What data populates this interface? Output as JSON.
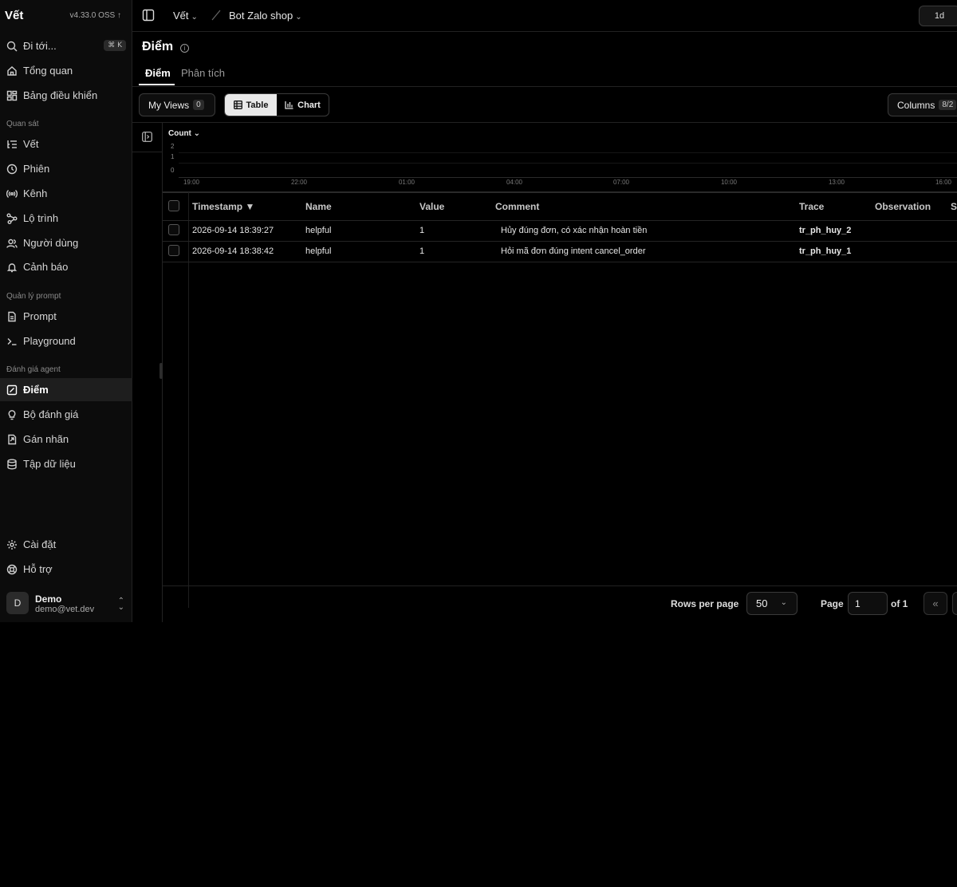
{
  "sidebar": {
    "brand": "Vết",
    "version": "v4.33.0 OSS",
    "goto_label": "Đi tới...",
    "goto_shortcut": "⌘ K",
    "items_top": [
      {
        "label": "Tổng quan",
        "icon": "home-icon"
      },
      {
        "label": "Bảng điều khiển",
        "icon": "dashboard-icon"
      }
    ],
    "section_observe": "Quan sát",
    "items_observe": [
      {
        "label": "Vết",
        "icon": "list-tree-icon"
      },
      {
        "label": "Phiên",
        "icon": "clock-icon"
      },
      {
        "label": "Kênh",
        "icon": "radio-icon"
      },
      {
        "label": "Lộ trình",
        "icon": "route-icon"
      },
      {
        "label": "Người dùng",
        "icon": "users-icon"
      },
      {
        "label": "Cảnh báo",
        "icon": "bell-icon"
      }
    ],
    "section_prompt": "Quản lý prompt",
    "items_prompt": [
      {
        "label": "Prompt",
        "icon": "file-text-icon"
      },
      {
        "label": "Playground",
        "icon": "terminal-icon"
      }
    ],
    "section_eval": "Đánh giá agent",
    "items_eval": [
      {
        "label": "Điểm",
        "icon": "score-icon",
        "active": true
      },
      {
        "label": "Bộ đánh giá",
        "icon": "lightbulb-icon"
      },
      {
        "label": "Gán nhãn",
        "icon": "tag-icon"
      },
      {
        "label": "Tập dữ liệu",
        "icon": "database-icon"
      }
    ],
    "items_bottom": [
      {
        "label": "Cài đặt",
        "icon": "gear-icon"
      },
      {
        "label": "Hỗ trợ",
        "icon": "lifebuoy-icon"
      }
    ],
    "user": {
      "initial": "D",
      "name": "Demo",
      "email": "demo@vet.dev"
    }
  },
  "topbar": {
    "crumb1": "Vết",
    "crumb2": "Bot Zalo shop",
    "range": "1d"
  },
  "page": {
    "title": "Điểm",
    "tabs": [
      "Điểm",
      "Phân tích"
    ],
    "my_views_label": "My Views",
    "my_views_count": "0",
    "table_label": "Table",
    "chart_label": "Chart",
    "columns_label": "Columns",
    "columns_count": "8/2"
  },
  "chart_data": {
    "type": "bar",
    "ylabel": "Count",
    "y_ticks": [
      "2",
      "1",
      "0"
    ],
    "x_ticks": [
      "19:00",
      "22:00",
      "01:00",
      "04:00",
      "07:00",
      "10:00",
      "13:00",
      "16:00"
    ],
    "series": []
  },
  "table": {
    "headers": [
      "Timestamp ▼",
      "Name",
      "Value",
      "Comment",
      "Trace",
      "Observation",
      "S"
    ],
    "rows": [
      {
        "timestamp": "2026-09-14 18:39:27",
        "name": "helpful",
        "value": "1",
        "comment": "Hủy đúng đơn, có xác nhận hoàn tiền",
        "trace": "tr_ph_huy_2"
      },
      {
        "timestamp": "2026-09-14 18:38:42",
        "name": "helpful",
        "value": "1",
        "comment": "Hỏi mã đơn đúng intent cancel_order",
        "trace": "tr_ph_huy_1"
      }
    ]
  },
  "footer": {
    "rows_per_page_label": "Rows per page",
    "rows_per_page": "50",
    "page_label": "Page",
    "page_value": "1",
    "of_label": "of 1",
    "first_page": "«"
  }
}
